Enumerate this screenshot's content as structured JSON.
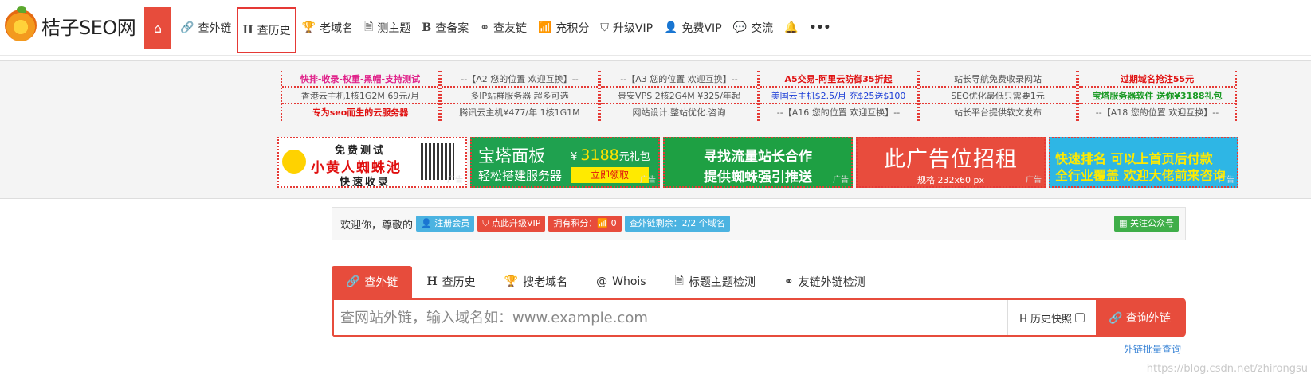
{
  "logo": {
    "text": "桔子SEO网"
  },
  "nav": {
    "home_icon": "⌂",
    "items": [
      {
        "icon": "🔗",
        "label": "查外链"
      },
      {
        "icon": "H",
        "label": "查历史"
      },
      {
        "icon": "🏆",
        "label": "老域名"
      },
      {
        "icon": "🗎",
        "label": "测主题"
      },
      {
        "icon": "B",
        "label": "查备案"
      },
      {
        "icon": "⚭",
        "label": "查友链"
      },
      {
        "icon": "📶",
        "label": "充积分"
      },
      {
        "icon": "⛉",
        "label": "升级VIP"
      },
      {
        "icon": "👤",
        "label": "免费VIP"
      },
      {
        "icon": "💬",
        "label": "交流"
      }
    ],
    "bell_icon": "🔔",
    "more_icon": "•••"
  },
  "text_ads": [
    [
      "快排-收录-权重-黑帽-支持测试",
      "香港云主机1核1G2M 69元/月",
      "专为seo而生的云服务器"
    ],
    [
      "--【A2 您的位置 欢迎互换】--",
      "多IP站群服务器 超多可选",
      "腾讯云主机¥477/年 1核1G1M"
    ],
    [
      "--【A3 您的位置 欢迎互换】--",
      "景安VPS 2核2G4M ¥325/年起",
      "网站设计.整站优化.咨询"
    ],
    [
      "A5交易-阿里云防御35折起",
      "美国云主机$2.5/月 充$25送$100",
      "--【A16 您的位置 欢迎互换】--"
    ],
    [
      "站长导航免费收录网站",
      "SEO优化最低只需要1元",
      "站长平台提供软文发布"
    ],
    [
      "过期域名抢注55元",
      "宝塔服务器软件 送你¥3188礼包",
      "--【A18 您的位置 欢迎互换】--"
    ]
  ],
  "banners": {
    "tag": "广告",
    "b1": {
      "l1": "免费测试",
      "l2": "小黄人蜘蛛池",
      "l3": "快速收录"
    },
    "b2": {
      "l1": "宝塔面板",
      "price_sym": "¥",
      "price": "3188",
      "price_unit": "元礼包",
      "l2": "轻松搭建服务器",
      "btn": "立即领取"
    },
    "b3": {
      "l1": "寻找流量站长合作",
      "l2": "提供蜘蛛强引推送"
    },
    "b4": {
      "l1": "此广告位招租",
      "l2": "规格 232x60 px"
    },
    "b5": {
      "l1": "快速排名  可以上首页后付款",
      "l2": "全行业覆盖 欢迎大佬前来咨询"
    }
  },
  "welcome": {
    "text": "欢迎你，尊敬的",
    "register": "👤 注册会员",
    "upgrade": "⛉ 点此升级VIP",
    "points": "拥有积分：📶 0",
    "remaining": "查外链剩余：2/2 个域名",
    "follow": "▦ 关注公众号"
  },
  "search": {
    "tabs": [
      {
        "icon": "🔗",
        "label": "查外链"
      },
      {
        "icon": "H",
        "label": "查历史"
      },
      {
        "icon": "🏆",
        "label": "搜老域名"
      },
      {
        "icon": "@",
        "label": "Whois"
      },
      {
        "icon": "🗎",
        "label": "标题主题检测"
      },
      {
        "icon": "⚭",
        "label": "友链外链检测"
      }
    ],
    "placeholder": "查网站外链，输入域名如：www.example.com",
    "history_label": "H 历史快照",
    "button": "🔗 查询外链",
    "batch": "外链批量查询"
  },
  "watermark": "https://blog.csdn.net/zhirongsu"
}
